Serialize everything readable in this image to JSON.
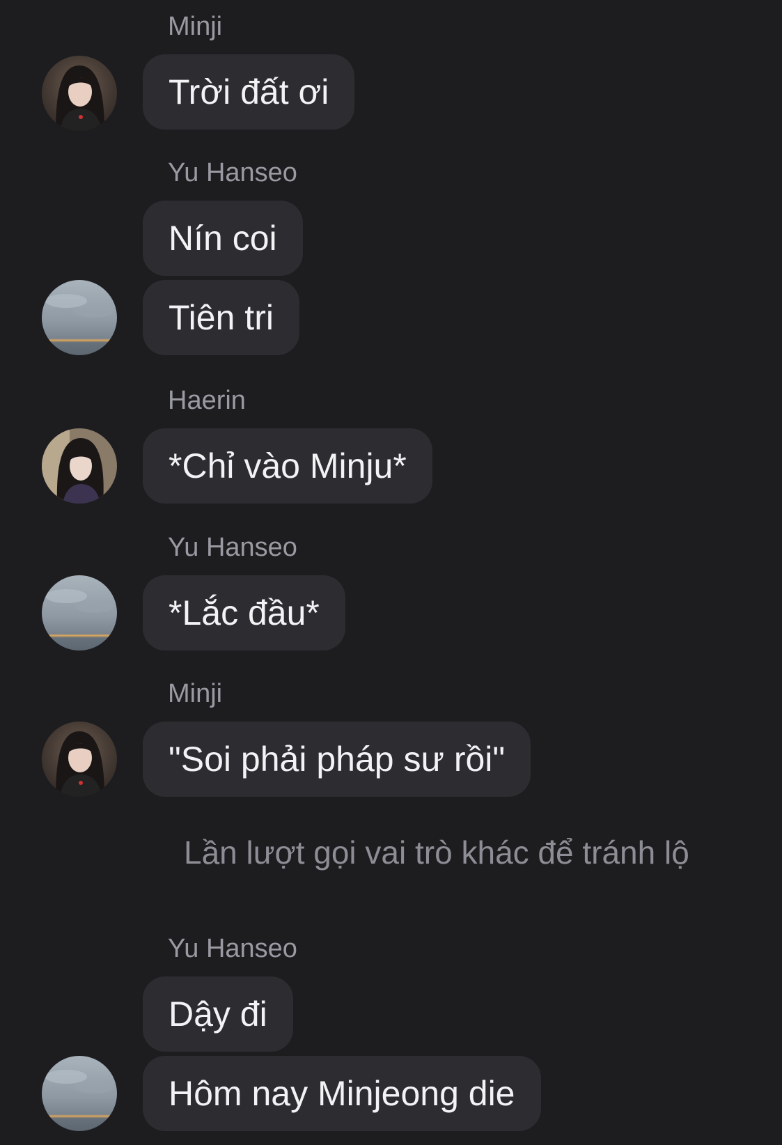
{
  "messages": [
    {
      "sender": "Minji",
      "text": "Trời đất ơi"
    },
    {
      "sender": "Yu Hanseo",
      "text": "Nín coi"
    },
    {
      "text": "Tiên tri"
    },
    {
      "sender": "Haerin",
      "text": "*Chỉ vào Minju*"
    },
    {
      "sender": "Yu Hanseo",
      "text": "*Lắc đầu*"
    },
    {
      "sender": "Minji",
      "text": "\"Soi phải pháp sư rồi\""
    },
    {
      "sender": "Yu Hanseo",
      "text": "Dậy đi"
    },
    {
      "text": "Hôm nay Minjeong die"
    }
  ],
  "system_notice": "Lần lượt gọi vai trò khác để tránh lộ",
  "avatars": {
    "minji": "portrait-photo",
    "yu_hanseo": "cloudy-sky-photo",
    "haerin": "portrait-photo"
  }
}
